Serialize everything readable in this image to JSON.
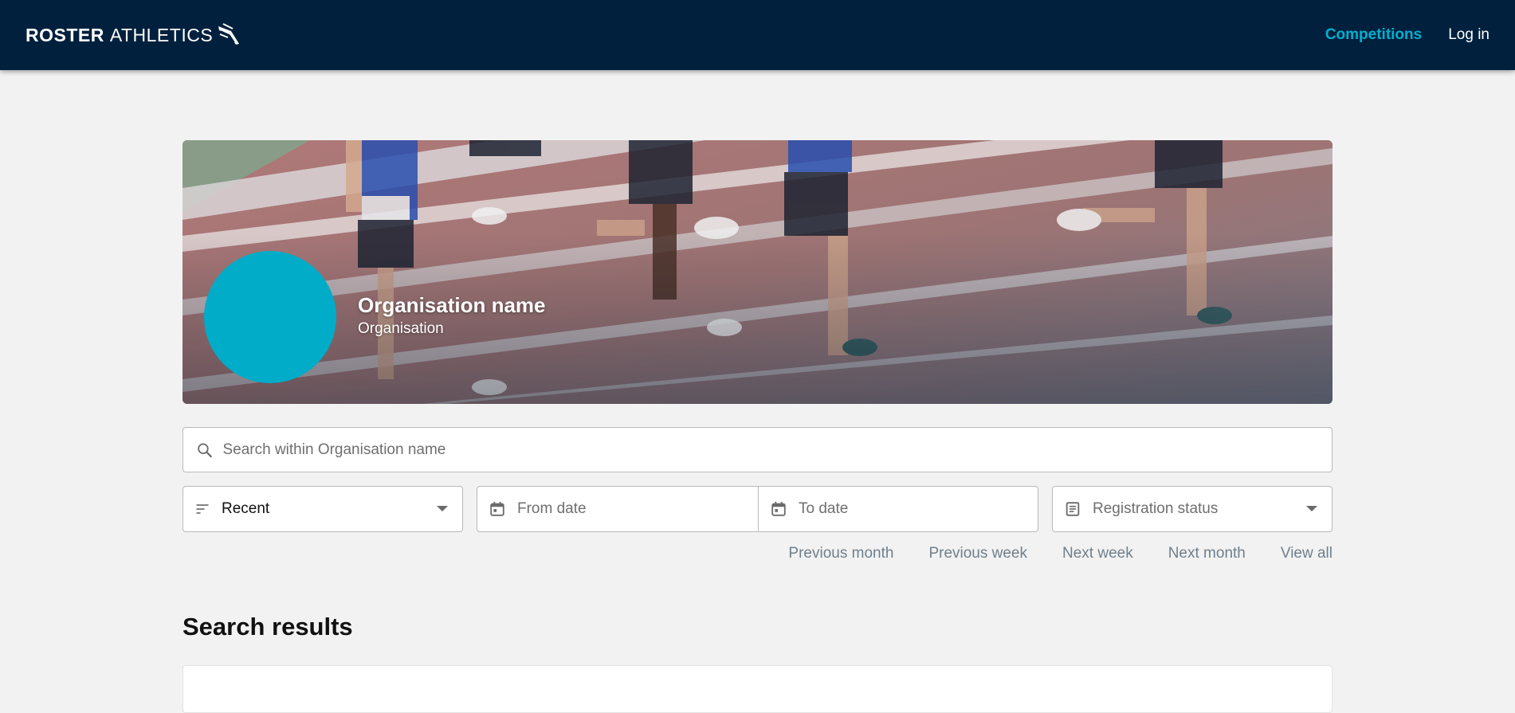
{
  "header": {
    "logo_bold": "ROSTER",
    "logo_light": "ATHLETICS",
    "nav": [
      {
        "label": "Competitions",
        "active": true
      },
      {
        "label": "Log in",
        "active": false
      }
    ],
    "background_color": "#00203d",
    "accent_color": "#00b0d0"
  },
  "hero": {
    "org_name": "Organisation name",
    "org_type": "Organisation",
    "avatar_color": "#00acc7"
  },
  "search": {
    "placeholder": "Search within Organisation name"
  },
  "filters": {
    "sort_value": "Recent",
    "from_placeholder": "From date",
    "to_placeholder": "To date",
    "registration_placeholder": "Registration status"
  },
  "quick_links": [
    "Previous month",
    "Previous week",
    "Next week",
    "Next month",
    "View all"
  ],
  "results": {
    "title": "Search results"
  }
}
